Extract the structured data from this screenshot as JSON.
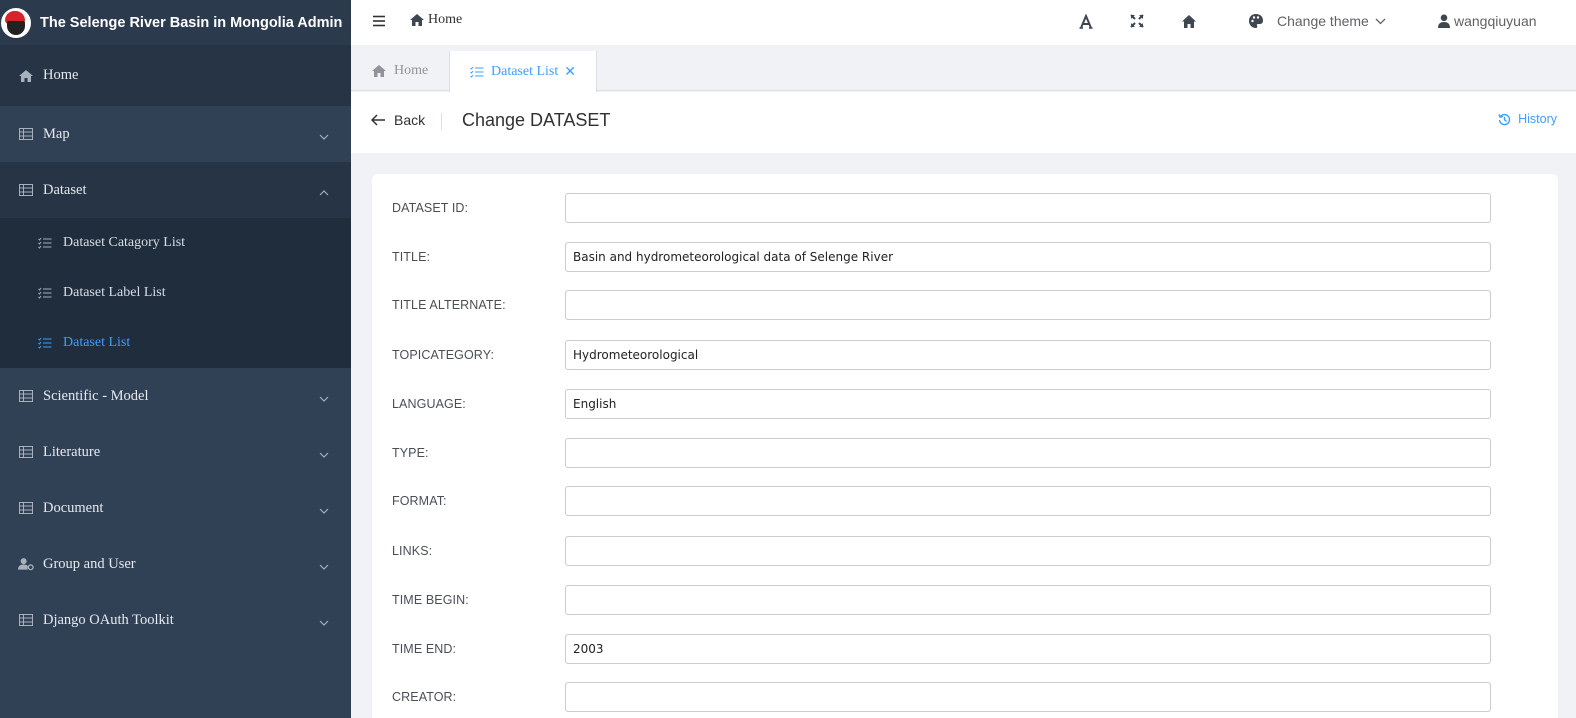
{
  "app": {
    "title": "The Selenge River Basin in Mongolia Admin"
  },
  "sidebar": {
    "items": [
      {
        "label": "Home",
        "icon": "house-icon"
      },
      {
        "label": "Map",
        "icon": "table-icon"
      },
      {
        "label": "Dataset",
        "icon": "table-icon",
        "expanded": true
      },
      {
        "label": "Scientific - Model",
        "icon": "table-icon"
      },
      {
        "label": "Literature",
        "icon": "table-icon"
      },
      {
        "label": "Document",
        "icon": "table-icon"
      },
      {
        "label": "Group and User",
        "icon": "user-gear-icon"
      },
      {
        "label": "Django OAuth Toolkit",
        "icon": "table-icon"
      }
    ],
    "dataset_children": [
      {
        "label": "Dataset Catagory List",
        "active": false
      },
      {
        "label": "Dataset Label List",
        "active": false
      },
      {
        "label": "Dataset List",
        "active": true
      }
    ]
  },
  "topbar": {
    "breadcrumb": "Home",
    "theme_label": "Change theme",
    "username": "wangqiuyuan",
    "icons": [
      "font-size-icon",
      "fullscreen-icon",
      "home-icon",
      "palette-icon"
    ]
  },
  "tabs": [
    {
      "label": "Home",
      "active": false
    },
    {
      "label": "Dataset List",
      "active": true
    }
  ],
  "page": {
    "back_label": "Back",
    "title": "Change DATASET",
    "history_label": "History"
  },
  "form": {
    "fields": [
      {
        "label": "DATASET ID:",
        "value": ""
      },
      {
        "label": "TITLE:",
        "value": "Basin and hydrometeorological data of Selenge River"
      },
      {
        "label": "TITLE ALTERNATE:",
        "value": ""
      },
      {
        "label": "TOPICATEGORY:",
        "value": "Hydrometeorological"
      },
      {
        "label": "LANGUAGE:",
        "value": "English"
      },
      {
        "label": "TYPE:",
        "value": ""
      },
      {
        "label": "FORMAT:",
        "value": ""
      },
      {
        "label": "LINKS:",
        "value": ""
      },
      {
        "label": "TIME BEGIN:",
        "value": ""
      },
      {
        "label": "TIME END:",
        "value": "2003"
      },
      {
        "label": "CREATOR:",
        "value": ""
      }
    ]
  },
  "colors": {
    "sidebar_bg": "#304156",
    "accent": "#409eff"
  }
}
